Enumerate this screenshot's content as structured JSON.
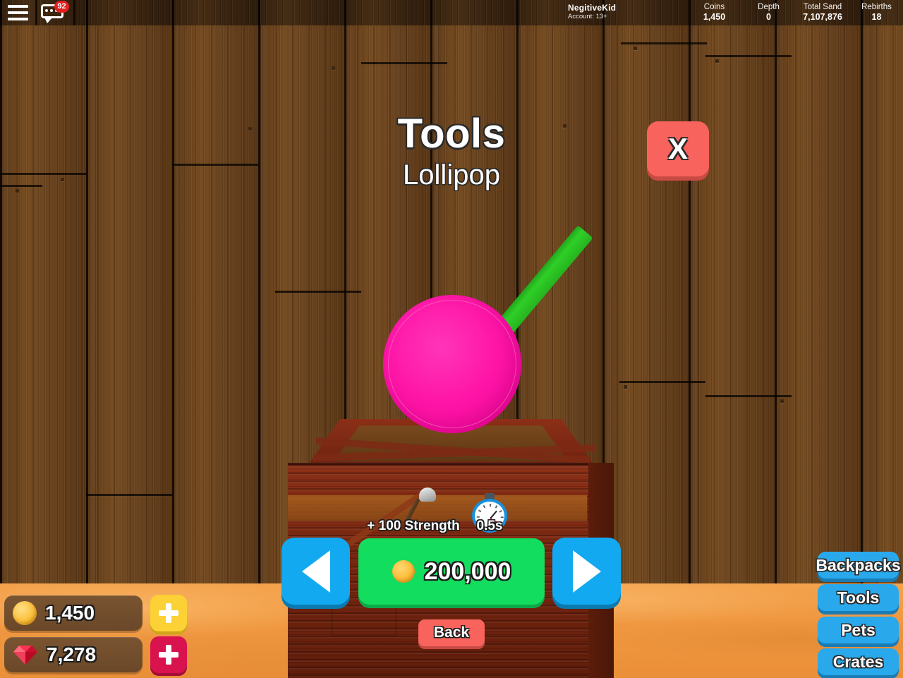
{
  "topbar": {
    "menu_icon": "hamburger-icon",
    "chat_icon": "chat-bubble-icon",
    "chat_badge": "92",
    "player_name": "NegitiveKid",
    "player_account": "Account: 13+",
    "stats": [
      {
        "label": "Coins",
        "value": "1,450"
      },
      {
        "label": "Depth",
        "value": "0"
      },
      {
        "label": "Total Sand",
        "value": "7,107,876"
      },
      {
        "label": "Rebirths",
        "value": "18"
      }
    ]
  },
  "panel": {
    "title": "Tools",
    "item_name": "Lollipop",
    "close_label": "X",
    "back_label": "Back"
  },
  "item": {
    "strength_label": "+ 100 Strength",
    "strength_icon": "shovel-icon",
    "speed_label": "0.5s",
    "speed_icon": "stopwatch-icon",
    "price": "200,000",
    "price_icon": "coin-icon",
    "prev_icon": "arrow-left-icon",
    "next_icon": "arrow-right-icon"
  },
  "hud": {
    "coins": {
      "icon": "coin-icon",
      "value": "1,450",
      "add_icon": "plus-icon"
    },
    "gems": {
      "icon": "gem-icon",
      "value": "7,278",
      "add_icon": "plus-icon"
    }
  },
  "menu": {
    "items": [
      {
        "label": "Backpacks"
      },
      {
        "label": "Tools"
      },
      {
        "label": "Pets"
      },
      {
        "label": "Crates"
      }
    ]
  },
  "colors": {
    "wood_wall": "#6d4520",
    "topbar_wood": "#3a2410",
    "sand": "#f2993f",
    "blue_button": "#2aa8ec",
    "blue_arrow": "#12a9f0",
    "green_buy": "#12dd5e",
    "red_close": "#f8645d",
    "coin_gold": "#fbc03c",
    "gem_red": "#d8134e",
    "crate_wood": "#7d2912",
    "lollipop_pink": "#ff17a8",
    "lollipop_stick_green": "#2fcf27"
  }
}
